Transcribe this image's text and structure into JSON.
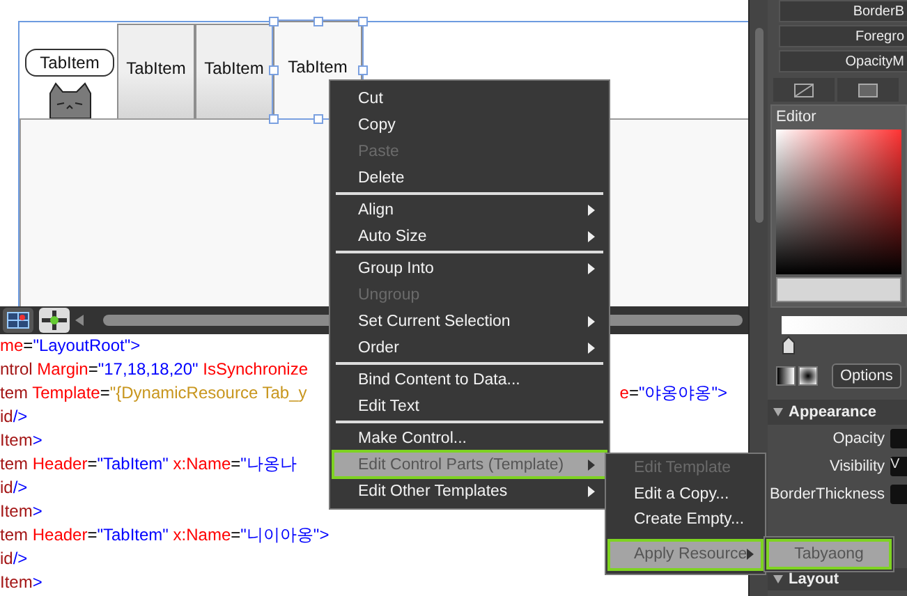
{
  "design_canvas": {
    "tabs": [
      {
        "header": "TabItem",
        "kind": "bubble",
        "selected": false
      },
      {
        "header": "TabItem",
        "kind": "plain",
        "selected": false
      },
      {
        "header": "TabItem",
        "kind": "plain",
        "selected": false
      },
      {
        "header": "TabItem",
        "kind": "plain",
        "selected": true
      }
    ]
  },
  "code_lines": [
    {
      "tokens": [
        {
          "text": "me",
          "kind": "attr"
        },
        {
          "text": "=",
          "kind": "eq"
        },
        {
          "text": "\"LayoutRoot\"",
          "kind": "value"
        },
        {
          "text": ">",
          "kind": "punct"
        }
      ]
    },
    {
      "tokens": [
        {
          "text": "ntrol",
          "kind": "tag"
        },
        {
          "text": " Margin",
          "kind": "attr"
        },
        {
          "text": "=",
          "kind": "eq"
        },
        {
          "text": "\"17,18,18,20\"",
          "kind": "value"
        },
        {
          "text": " IsSynchronize",
          "kind": "attr"
        }
      ]
    },
    {
      "tokens": [
        {
          "text": "tem",
          "kind": "tag"
        },
        {
          "text": " Template",
          "kind": "attr"
        },
        {
          "text": "=",
          "kind": "eq"
        },
        {
          "text": "\"{DynamicResource Tab_y",
          "kind": "resource"
        }
      ],
      "tail": [
        {
          "text": "e",
          "kind": "attr"
        },
        {
          "text": "=",
          "kind": "eq"
        },
        {
          "text": "\"야옹야옹\"",
          "kind": "value"
        },
        {
          "text": ">",
          "kind": "punct"
        }
      ]
    },
    {
      "tokens": [
        {
          "text": "id",
          "kind": "tag"
        },
        {
          "text": "/>",
          "kind": "punct"
        }
      ]
    },
    {
      "tokens": [
        {
          "text": "Item",
          "kind": "tag"
        },
        {
          "text": ">",
          "kind": "punct"
        }
      ]
    },
    {
      "tokens": [
        {
          "text": "tem",
          "kind": "tag"
        },
        {
          "text": " Header",
          "kind": "attr"
        },
        {
          "text": "=",
          "kind": "eq"
        },
        {
          "text": "\"TabItem\"",
          "kind": "value"
        },
        {
          "text": " x:Name",
          "kind": "attr"
        },
        {
          "text": "=",
          "kind": "eq"
        },
        {
          "text": "\"나옹나",
          "kind": "value"
        }
      ]
    },
    {
      "tokens": [
        {
          "text": "id",
          "kind": "tag"
        },
        {
          "text": "/>",
          "kind": "punct"
        }
      ]
    },
    {
      "tokens": [
        {
          "text": "Item",
          "kind": "tag"
        },
        {
          "text": ">",
          "kind": "punct"
        }
      ]
    },
    {
      "tokens": [
        {
          "text": "tem",
          "kind": "tag"
        },
        {
          "text": " Header",
          "kind": "attr"
        },
        {
          "text": "=",
          "kind": "eq"
        },
        {
          "text": "\"TabItem\"",
          "kind": "value"
        },
        {
          "text": " x:Name",
          "kind": "attr"
        },
        {
          "text": "=",
          "kind": "eq"
        },
        {
          "text": "\"니이아옹\"",
          "kind": "value"
        },
        {
          "text": ">",
          "kind": "punct"
        }
      ]
    },
    {
      "tokens": [
        {
          "text": "id",
          "kind": "tag"
        },
        {
          "text": "/>",
          "kind": "punct"
        }
      ]
    },
    {
      "tokens": [
        {
          "text": "Item",
          "kind": "tag"
        },
        {
          "text": ">",
          "kind": "punct"
        }
      ]
    }
  ],
  "context_menu": {
    "items": [
      {
        "kind": "item",
        "label": "Cut",
        "disabled": false,
        "has_submenu": false,
        "highlighted": false
      },
      {
        "kind": "item",
        "label": "Copy",
        "disabled": false,
        "has_submenu": false,
        "highlighted": false
      },
      {
        "kind": "item",
        "label": "Paste",
        "disabled": true,
        "has_submenu": false,
        "highlighted": false
      },
      {
        "kind": "item",
        "label": "Delete",
        "disabled": false,
        "has_submenu": false,
        "highlighted": false
      },
      {
        "kind": "separator"
      },
      {
        "kind": "item",
        "label": "Align",
        "disabled": false,
        "has_submenu": true,
        "highlighted": false
      },
      {
        "kind": "item",
        "label": "Auto Size",
        "disabled": false,
        "has_submenu": true,
        "highlighted": false
      },
      {
        "kind": "separator"
      },
      {
        "kind": "item",
        "label": "Group Into",
        "disabled": false,
        "has_submenu": true,
        "highlighted": false
      },
      {
        "kind": "item",
        "label": "Ungroup",
        "disabled": true,
        "has_submenu": false,
        "highlighted": false
      },
      {
        "kind": "item",
        "label": "Set Current Selection",
        "disabled": false,
        "has_submenu": true,
        "highlighted": false
      },
      {
        "kind": "item",
        "label": "Order",
        "disabled": false,
        "has_submenu": true,
        "highlighted": false
      },
      {
        "kind": "separator"
      },
      {
        "kind": "item",
        "label": "Bind Content to Data...",
        "disabled": false,
        "has_submenu": false,
        "highlighted": false
      },
      {
        "kind": "item",
        "label": "Edit Text",
        "disabled": false,
        "has_submenu": false,
        "highlighted": false
      },
      {
        "kind": "separator"
      },
      {
        "kind": "item",
        "label": "Make Control...",
        "disabled": false,
        "has_submenu": false,
        "highlighted": false
      },
      {
        "kind": "item",
        "label": "Edit Control Parts (Template)",
        "disabled": false,
        "has_submenu": true,
        "highlighted": true
      },
      {
        "kind": "item",
        "label": "Edit Other Templates",
        "disabled": false,
        "has_submenu": true,
        "highlighted": false
      }
    ]
  },
  "submenu": {
    "items": [
      {
        "kind": "item",
        "label": "Edit Template",
        "disabled": true,
        "has_submenu": false,
        "highlighted": false
      },
      {
        "kind": "item",
        "label": "Edit a Copy...",
        "disabled": false,
        "has_submenu": false,
        "highlighted": false
      },
      {
        "kind": "item",
        "label": "Create Empty...",
        "disabled": false,
        "has_submenu": false,
        "highlighted": false
      },
      {
        "kind": "item",
        "label": "Apply Resource",
        "disabled": false,
        "has_submenu": true,
        "highlighted": true
      }
    ]
  },
  "resource_menu": {
    "items": [
      {
        "kind": "item",
        "label": "Tabyaong",
        "has_submenu": false,
        "highlighted": true
      }
    ]
  },
  "properties_panel": {
    "brush_rows": [
      "BorderB",
      "Foregro",
      "OpacityM"
    ],
    "editor_label": "Editor",
    "options_button": "Options",
    "sections": [
      {
        "title": "Appearance",
        "expanded": true,
        "properties": [
          {
            "label": "Opacity"
          },
          {
            "label": "Visibility",
            "value": "V"
          },
          {
            "label": "BorderThickness"
          }
        ]
      },
      {
        "title": "Layout",
        "expanded": true
      }
    ]
  }
}
